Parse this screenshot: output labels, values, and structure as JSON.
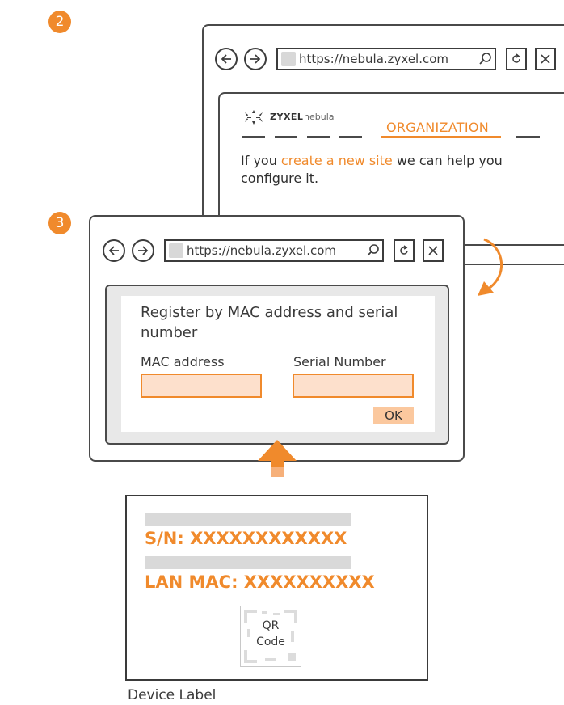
{
  "steps": {
    "step2": "2",
    "step3": "3"
  },
  "browser_back": {
    "url": "https://nebula.zyxel.com",
    "logo_brand": "ZYXEL",
    "logo_product": "nebula",
    "progress_step_label": "ORGANIZATION",
    "message_prefix": "If you ",
    "message_link": "create a new site",
    "message_suffix": " we can help you configure it."
  },
  "browser_front": {
    "url": "https://nebula.zyxel.com",
    "form_title": "Register by MAC address and serial number",
    "mac_label": "MAC address",
    "serial_label": "Serial Number",
    "ok_label": "OK"
  },
  "device_label": {
    "sn_line": "S/N: XXXXXXXXXXXX",
    "mac_line": "LAN MAC: XXXXXXXXXX",
    "qr_line1": "QR",
    "qr_line2": "Code",
    "caption": "Device Label"
  },
  "colors": {
    "accent": "#f08a2c",
    "field_fill": "#fde0cc",
    "frame": "#4a4a4a",
    "panel": "#e8e8e8"
  },
  "icons": [
    "back-arrow-icon",
    "forward-arrow-icon",
    "ie-icon",
    "magnifier-icon",
    "refresh-icon",
    "close-icon",
    "curved-arrow-icon",
    "up-arrow-icon",
    "qr-code-icon"
  ]
}
